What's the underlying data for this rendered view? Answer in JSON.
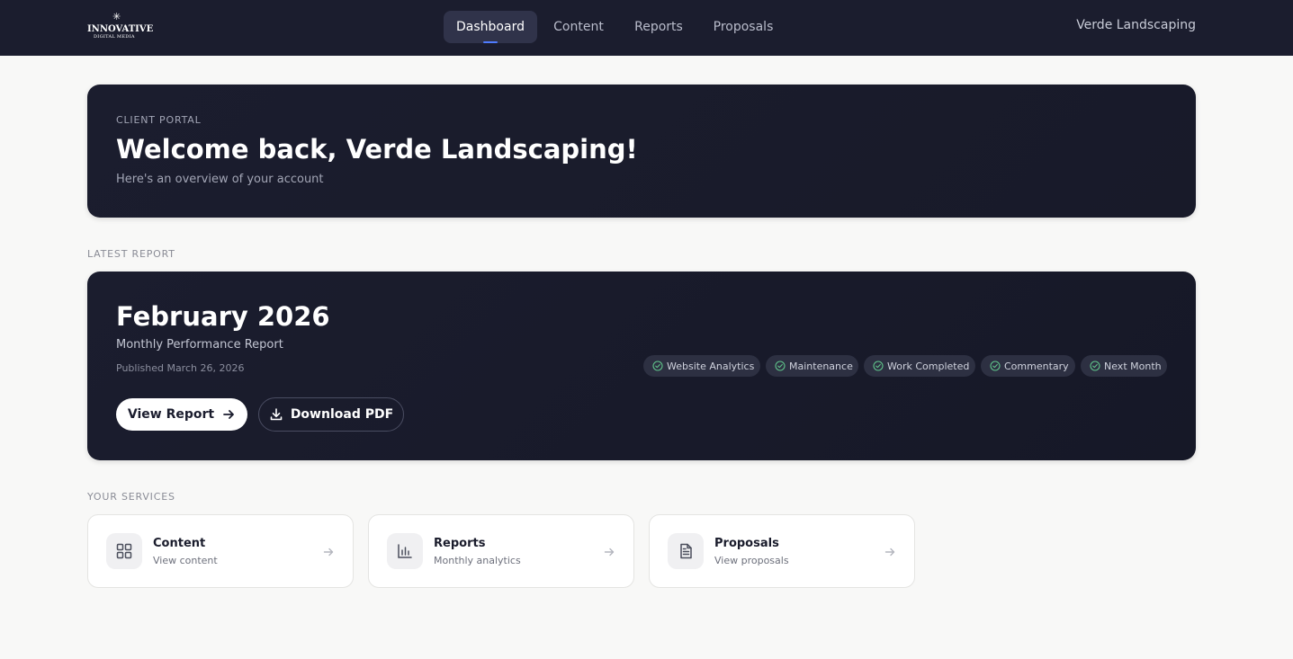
{
  "header": {
    "logo": {
      "main": "INNOVATIVE",
      "sub": "DIGITAL MEDIA",
      "mark": "✳"
    },
    "nav": [
      {
        "id": "dashboard",
        "label": "Dashboard",
        "active": true
      },
      {
        "id": "content",
        "label": "Content",
        "active": false
      },
      {
        "id": "reports",
        "label": "Reports",
        "active": false
      },
      {
        "id": "proposals",
        "label": "Proposals",
        "active": false
      }
    ],
    "account_name": "Verde Landscaping"
  },
  "hero": {
    "eyebrow": "CLIENT PORTAL",
    "title": "Welcome back, Verde Landscaping!",
    "subtitle": "Here's an overview of your account"
  },
  "latest_report": {
    "section_label": "LATEST REPORT",
    "title": "February 2026",
    "subtitle": "Monthly Performance Report",
    "published": "Published March 26, 2026",
    "view_label": "View Report",
    "download_label": "Download PDF",
    "chips": [
      {
        "label": "Website Analytics",
        "icon": "check-circle-icon"
      },
      {
        "label": "Maintenance",
        "icon": "check-circle-icon"
      },
      {
        "label": "Work Completed",
        "icon": "check-circle-icon"
      },
      {
        "label": "Commentary",
        "icon": "check-circle-icon"
      },
      {
        "label": "Next Month",
        "icon": "check-circle-icon"
      }
    ]
  },
  "services": {
    "section_label": "YOUR SERVICES",
    "cards": [
      {
        "title": "Content",
        "subtitle": "View content",
        "icon": "grid-icon"
      },
      {
        "title": "Reports",
        "subtitle": "Monthly analytics",
        "icon": "bar-chart-icon"
      },
      {
        "title": "Proposals",
        "subtitle": "View proposals",
        "icon": "document-icon"
      }
    ]
  },
  "colors": {
    "navy": "#1b1d2e",
    "page_bg": "#f8f8f7",
    "accent_blue": "#4f7cff",
    "check_green": "#5fc38a"
  }
}
